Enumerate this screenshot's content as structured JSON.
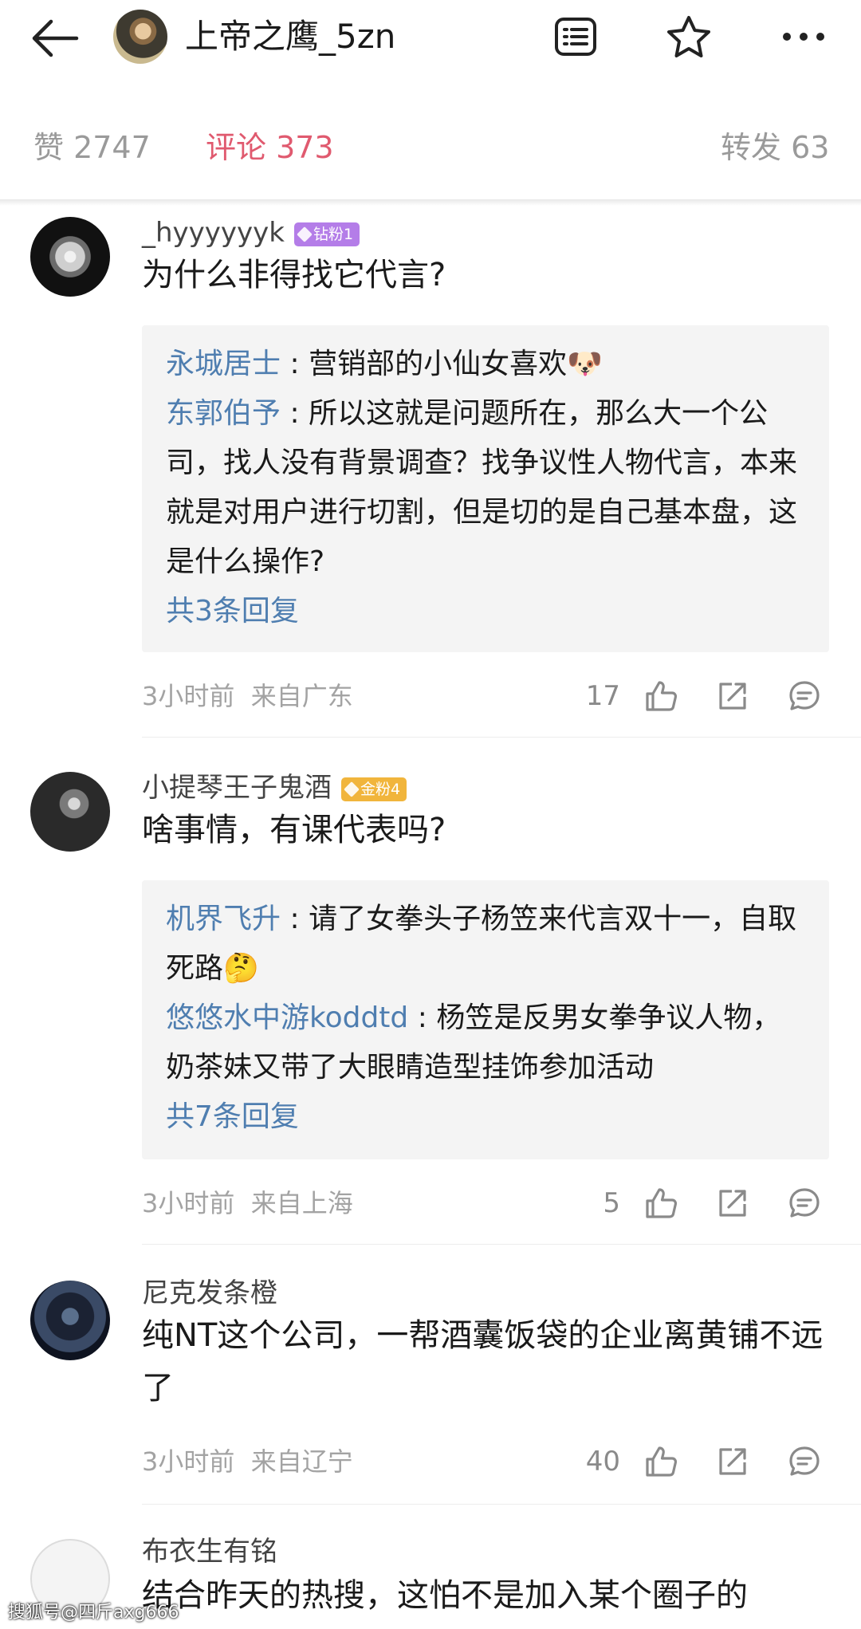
{
  "header": {
    "title": "上帝之鹰_5zn",
    "back_icon": "back-arrow-icon",
    "icons": [
      "reader-icon",
      "star-icon",
      "more-icon"
    ]
  },
  "tabs": [
    {
      "label": "赞 2747",
      "active": false
    },
    {
      "label": "评论 373",
      "active": true
    },
    {
      "label": "转发 63",
      "active": false
    }
  ],
  "colors": {
    "accent": "#e05a6f",
    "link": "#4f7eb0",
    "badge_diamond": "#b47de8",
    "badge_gold": "#f1b53c"
  },
  "comments": [
    {
      "username": "_hyyyyyyk",
      "badge": "钻粉1",
      "content": "为什么非得找它代言?",
      "replies": [
        {
          "name": "永城居士",
          "sep": ":",
          "text": "营销部的小仙女喜欢🐶"
        },
        {
          "name": "东郭伯予",
          "sep": ":",
          "text": "所以这就是问题所在，那么大一个公司，找人没有背景调查？找争议性人物代言，本来就是对用户进行切割，但是切的是自己基本盘，这是什么操作?"
        }
      ],
      "more": "共3条回复",
      "time": "3小时前",
      "location": "来自广东",
      "likes": "17"
    },
    {
      "username": "小提琴王子鬼酒",
      "badge": "金粉4",
      "content": "啥事情，有课代表吗?",
      "replies": [
        {
          "name": "机界飞升",
          "sep": ":",
          "text": "请了女拳头子杨笠来代言双十一，自取死路🤔"
        },
        {
          "name": "悠悠水中游koddtd",
          "sep": ":",
          "text": "杨笠是反男女拳争议人物，奶茶妹又带了大眼睛造型挂饰参加活动"
        }
      ],
      "more": "共7条回复",
      "time": "3小时前",
      "location": "来自上海",
      "likes": "5"
    },
    {
      "username": "尼克发条橙",
      "content": "纯NT这个公司，一帮酒囊饭袋的企业离黄铺不远了",
      "time": "3小时前",
      "location": "来自辽宁",
      "likes": "40"
    },
    {
      "username": "布衣生有铭",
      "content": "结合昨天的热搜，这怕不是加入某个圈子的"
    }
  ],
  "watermark": "搜狐号@四斤axg666"
}
